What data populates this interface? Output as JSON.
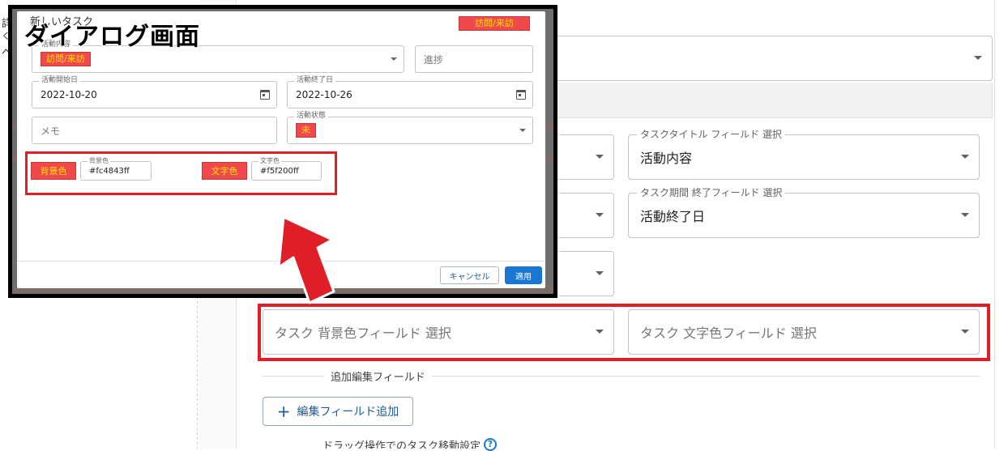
{
  "background": {
    "left_text": [
      "詳",
      "く",
      "ペ"
    ],
    "main_fields": {
      "top_select": {
        "value": ""
      },
      "task_title_field": {
        "label": "タスクタイトル フィールド 選択",
        "value": "活動内容"
      },
      "task_end_field": {
        "label": "タスク期間 終了フィールド 選択",
        "value": "活動終了日"
      },
      "bg_color_field": {
        "placeholder": "タスク 背景色フィールド 選択"
      },
      "text_color_field": {
        "placeholder": "タスク 文字色フィールド 選択"
      }
    },
    "section_title": "追加編集フィールド",
    "add_button": {
      "label": "編集フィールド追加"
    },
    "bottom_cut_text": "ドラッグ操作でのタスク移動設定"
  },
  "dialog": {
    "title": "新しいタスク",
    "header_badge": "訪問/来訪",
    "overlay_label": "ダイアログ画面",
    "activity_content": {
      "label": "活動内容",
      "value": "訪問/来訪"
    },
    "progress": {
      "placeholder": "進捗"
    },
    "start_date": {
      "label": "活動開始日",
      "value": "2022-10-20"
    },
    "end_date": {
      "label": "活動終了日",
      "value": "2022-10-26"
    },
    "memo": {
      "placeholder": "メモ"
    },
    "status": {
      "label": "活動状態",
      "value": "未"
    },
    "bg_color": {
      "swatch": "背景色",
      "label": "背景色",
      "value": "#fc4843ff"
    },
    "text_color": {
      "swatch": "文字色",
      "label": "文字色",
      "value": "#f5f200ff"
    },
    "cancel_button": "キャンセル",
    "apply_button": "適用"
  },
  "colors": {
    "highlight_red": "#e01e28",
    "badge_red": "#f0484b",
    "badge_text": "#ffe600",
    "primary_blue": "#1976d2"
  }
}
